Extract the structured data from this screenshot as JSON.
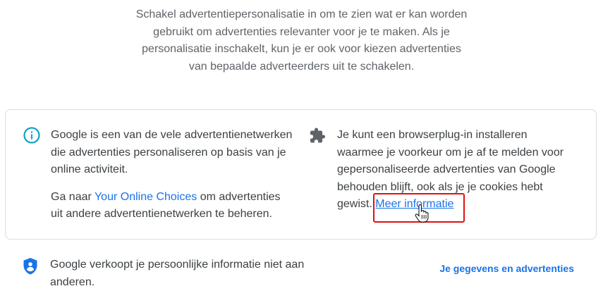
{
  "intro": {
    "lines": [
      "Schakel advertentiepersonalisatie in om te zien wat er kan worden",
      "gebruikt om advertenties relevanter voor je te maken. Als je",
      "personalisatie inschakelt, kun je er ook voor kiezen advertenties",
      "van bepaalde adverteerders uit te schakelen."
    ]
  },
  "card": {
    "left": {
      "icon": "info-icon",
      "para1": [
        "Google is een van de vele advertentienetwerken",
        "die advertenties personaliseren op basis van je",
        "online activiteit."
      ],
      "para2_prefix": "Ga naar ",
      "para2_link": "Your Online Choices",
      "para2_suffix": " om advertenties",
      "para2_line2": "uit andere advertentienetwerken te beheren."
    },
    "right": {
      "icon": "puzzle-piece-icon",
      "lines": [
        "Je kunt een browserplug-in installeren",
        "waarmee je voorkeur om je af te melden voor",
        "gepersonaliseerde advertenties van Google",
        "behouden blijft, ook als je je cookies hebt"
      ],
      "last_line_prefix": "gewist. ",
      "link": "Meer informatie"
    }
  },
  "bottom": {
    "icon": "shield-person-icon",
    "lines": [
      "Google verkoopt je persoonlijke informatie niet aan",
      "anderen."
    ],
    "link": "Je gegevens en advertenties"
  },
  "colors": {
    "accent": "#1a73e8",
    "info_icon": "#12a4c4",
    "shield_icon": "#1a73e8",
    "highlight": "#e01010"
  }
}
